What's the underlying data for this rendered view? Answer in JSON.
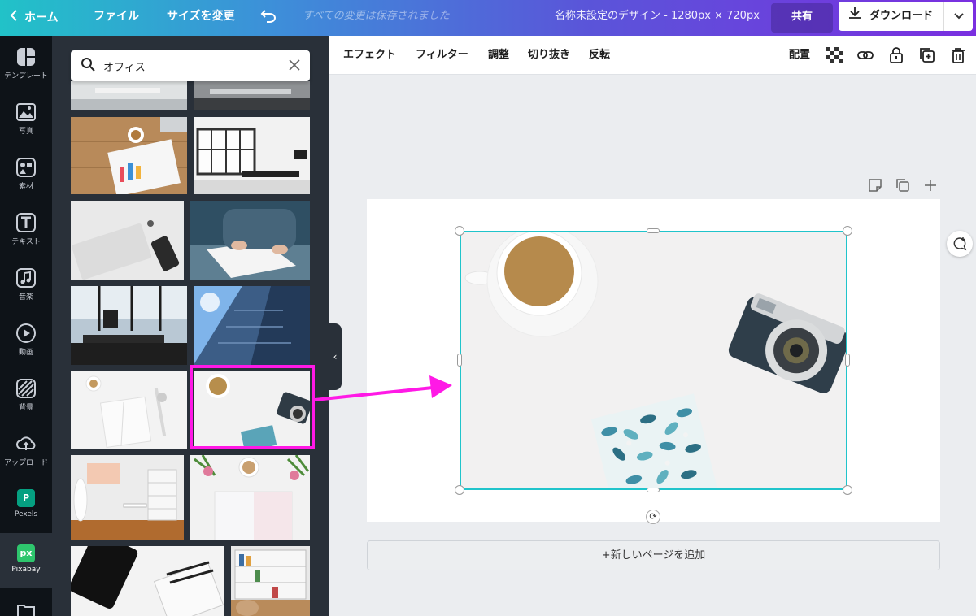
{
  "topbar": {
    "home": "ホーム",
    "file": "ファイル",
    "resize": "サイズを変更",
    "saved": "すべての変更は保存されました",
    "title": "名称未設定のデザイン - 1280px × 720px",
    "share": "共有",
    "download": "ダウンロード"
  },
  "rail": [
    {
      "label": "テンプレート",
      "icon": "template-icon"
    },
    {
      "label": "写真",
      "icon": "photo-icon"
    },
    {
      "label": "素材",
      "icon": "elements-icon"
    },
    {
      "label": "テキスト",
      "icon": "text-icon"
    },
    {
      "label": "音楽",
      "icon": "music-icon"
    },
    {
      "label": "動画",
      "icon": "video-icon"
    },
    {
      "label": "背景",
      "icon": "background-icon"
    },
    {
      "label": "アップロード",
      "icon": "upload-icon"
    },
    {
      "label": "Pexels",
      "icon": "pexels-icon"
    },
    {
      "label": "Pixabay",
      "icon": "pixabay-icon"
    }
  ],
  "search": {
    "value": "オフィス"
  },
  "toolbar": {
    "effects": "エフェクト",
    "filter": "フィルター",
    "adjust": "調整",
    "crop": "切り抜き",
    "flip": "反転",
    "position": "配置"
  },
  "canvas": {
    "add_page": "+新しいページを追加"
  },
  "colors": {
    "selection": "#20c4cb",
    "highlight": "#ff19e6",
    "rail_bg": "#0e1318",
    "panel_bg": "#293039"
  }
}
